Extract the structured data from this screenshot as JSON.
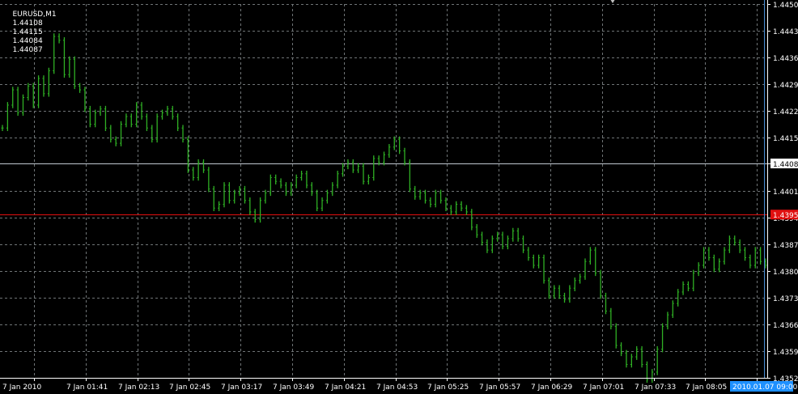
{
  "chart_data": {
    "type": "bar",
    "symbol": "EURUSD,M1",
    "ohlc": {
      "open": "1.44108",
      "high": "1.44115",
      "low": "1.44084",
      "close": "1.44087"
    },
    "ylim": [
      1.43525,
      1.44505
    ],
    "y_ticks": [
      "1.44505",
      "1.44435",
      "1.44365",
      "1.44295",
      "1.44225",
      "1.44155",
      "1.44087",
      "1.44015",
      "1.43945",
      "1.43875",
      "1.43805",
      "1.43735",
      "1.43665",
      "1.43595",
      "1.43525"
    ],
    "x_ticks": [
      "7 Jan 2010",
      "7 Jan 01:41",
      "7 Jan 02:13",
      "7 Jan 02:45",
      "7 Jan 03:17",
      "7 Jan 03:49",
      "7 Jan 04:21",
      "7 Jan 04:53",
      "7 Jan 05:25",
      "7 Jan 05:57",
      "7 Jan 06:29",
      "7 Jan 07:01",
      "7 Jan 07:33",
      "7 Jan 08:05",
      "7"
    ],
    "crosshair_time": "2010.01.07 09:00",
    "current_price_line": {
      "value": 1.44087,
      "label": "1.44087"
    },
    "marked_line": {
      "value": 1.43953,
      "label": "1.43953"
    },
    "grid": true,
    "series_close": [
      1.4418,
      1.4424,
      1.4428,
      1.4422,
      1.4426,
      1.4429,
      1.4424,
      1.4431,
      1.4427,
      1.4433,
      1.4442,
      1.4441,
      1.4432,
      1.4436,
      1.4429,
      1.4428,
      1.4423,
      1.4419,
      1.4422,
      1.4423,
      1.4418,
      1.4415,
      1.4414,
      1.4419,
      1.4421,
      1.4419,
      1.4424,
      1.4421,
      1.4418,
      1.4415,
      1.4421,
      1.4422,
      1.4423,
      1.4421,
      1.4418,
      1.4415,
      1.4407,
      1.4405,
      1.4409,
      1.4407,
      1.4402,
      1.4397,
      1.4398,
      1.4403,
      1.4399,
      1.4401,
      1.4402,
      1.4399,
      1.4396,
      1.4394,
      1.4399,
      1.4401,
      1.4405,
      1.4404,
      1.4403,
      1.4401,
      1.4403,
      1.4405,
      1.4406,
      1.4403,
      1.4401,
      1.4397,
      1.4399,
      1.4401,
      1.4403,
      1.4406,
      1.4408,
      1.4409,
      1.4407,
      1.4408,
      1.4404,
      1.4405,
      1.441,
      1.4409,
      1.4411,
      1.4413,
      1.4415,
      1.4412,
      1.4409,
      1.4402,
      1.44,
      1.4401,
      1.4399,
      1.4398,
      1.4401,
      1.4399,
      1.4397,
      1.4396,
      1.4398,
      1.4397,
      1.4396,
      1.4392,
      1.439,
      1.4388,
      1.4386,
      1.4389,
      1.439,
      1.4387,
      1.4389,
      1.4391,
      1.4389,
      1.4386,
      1.4384,
      1.4382,
      1.4384,
      1.4378,
      1.4374,
      1.4376,
      1.4374,
      1.4373,
      1.4376,
      1.4378,
      1.4379,
      1.4383,
      1.4386,
      1.438,
      1.4374,
      1.437,
      1.4366,
      1.4361,
      1.4359,
      1.4356,
      1.4358,
      1.436,
      1.4356,
      1.4352,
      1.4354,
      1.436,
      1.4366,
      1.4369,
      1.4372,
      1.4375,
      1.4377,
      1.4376,
      1.438,
      1.4382,
      1.4386,
      1.4384,
      1.4381,
      1.4383,
      1.4386,
      1.4389,
      1.4388,
      1.4386,
      1.4384,
      1.4382,
      1.4386,
      1.4383,
      1.4382
    ]
  }
}
